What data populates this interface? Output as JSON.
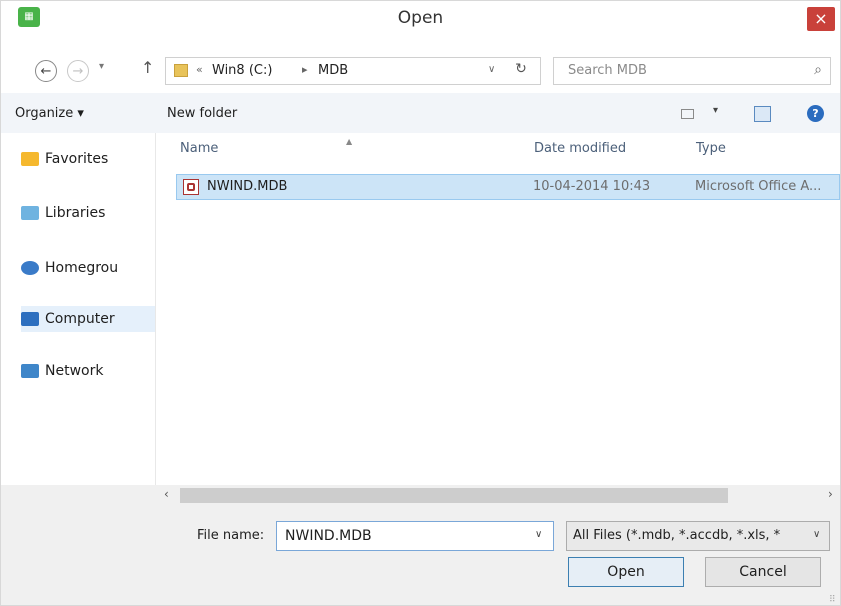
{
  "window": {
    "title": "Open",
    "close_glyph": "×",
    "app_icon": "spreadsheet-app-icon"
  },
  "nav": {
    "back_glyph": "←",
    "forward_glyph": "→",
    "recent_glyph": "▾",
    "up_glyph": "↑",
    "breadcrumb": {
      "overflow": "«",
      "items": [
        "Win8 (C:)",
        "MDB"
      ],
      "separator": "▸"
    },
    "address_dropdown_glyph": "∨",
    "refresh_glyph": "↻",
    "search_placeholder": "Search MDB",
    "search_glyph": "⌕"
  },
  "toolbar": {
    "organize_label": "Organize ▾",
    "new_folder_label": "New folder",
    "view_dd_glyph": "▾",
    "help_glyph": "?"
  },
  "sidebar": {
    "items": [
      {
        "label": "Favorites",
        "icon": "star-icon",
        "color": "#f5b82e"
      },
      {
        "label": "Libraries",
        "icon": "library-icon",
        "color": "#6fb3e0"
      },
      {
        "label": "Homegrou",
        "icon": "homegroup-icon",
        "color": "#3a7bc8"
      },
      {
        "label": "Computer",
        "icon": "computer-icon",
        "color": "#2d6fbf"
      },
      {
        "label": "Network",
        "icon": "network-icon",
        "color": "#3f86c9"
      }
    ]
  },
  "file_list": {
    "columns": [
      "Name",
      "Date modified",
      "Type"
    ],
    "sort_glyph": "▲",
    "rows": [
      {
        "name": "NWIND.MDB",
        "date_modified": "10-04-2014 10:43",
        "type": "Microsoft Office A...",
        "selected": true
      }
    ]
  },
  "scrollbar": {
    "left_glyph": "‹",
    "right_glyph": "›"
  },
  "bottom": {
    "file_name_label": "File name:",
    "file_name_value": "NWIND.MDB",
    "file_name_dd_glyph": "∨",
    "filter_value": "All Files (*.mdb, *.accdb, *.xls, *",
    "filter_dd_glyph": "∨",
    "open_label": "Open",
    "cancel_label": "Cancel"
  }
}
